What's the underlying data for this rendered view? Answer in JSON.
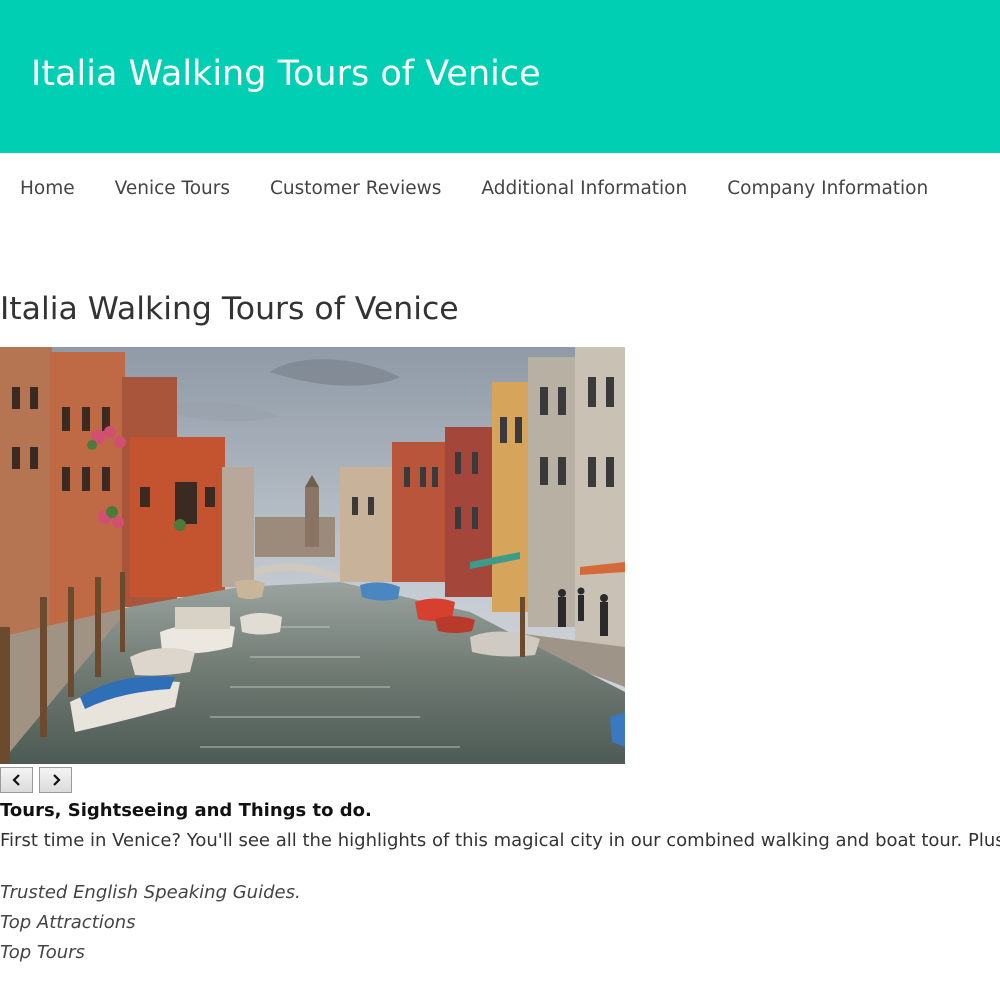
{
  "header": {
    "site_title": "Italia Walking Tours of Venice",
    "background_color": "#00cfb4"
  },
  "nav": {
    "items": [
      {
        "label": "Home"
      },
      {
        "label": "Venice Tours"
      },
      {
        "label": "Customer Reviews"
      },
      {
        "label": "Additional Information"
      },
      {
        "label": "Company Information"
      }
    ]
  },
  "main": {
    "heading": "Italia Walking Tours of Venice",
    "carousel": {
      "image_subject": "Venice canal with colorful buildings and moored boats",
      "prev_icon": "chevron-left-icon",
      "next_icon": "chevron-right-icon"
    },
    "tagline": "Tours, Sightseeing and Things to do.",
    "intro": "First time in Venice? You'll see all the highlights of this magical city in our combined walking and boat tour. Plus, y",
    "features": [
      "Trusted English Speaking Guides.",
      "Top Attractions",
      "Top Tours"
    ]
  }
}
